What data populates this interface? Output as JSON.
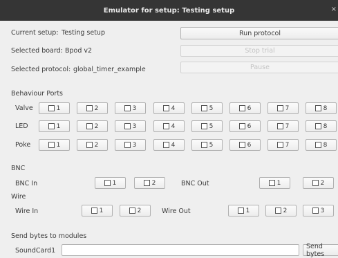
{
  "window": {
    "title": "Emulator for setup: Testing setup",
    "close_glyph": "×"
  },
  "info": {
    "current_setup_label": "Current setup:",
    "current_setup_value": "Testing setup",
    "board_label": "Selected board:",
    "board_value": "Bpod v2",
    "protocol_label": "Selected protocol:",
    "protocol_value": "global_timer_example"
  },
  "buttons": {
    "run": "Run protocol",
    "stop": "Stop trial",
    "pause": "Pause",
    "send": "Send bytes"
  },
  "behaviour": {
    "heading": "Behaviour Ports",
    "rows": [
      "Valve",
      "LED",
      "Poke"
    ],
    "ports": [
      "1",
      "2",
      "3",
      "4",
      "5",
      "6",
      "7",
      "8"
    ]
  },
  "bnc": {
    "heading": "BNC",
    "in_label": "BNC In",
    "out_label": "BNC Out",
    "in_ports": [
      "1",
      "2"
    ],
    "out_ports": [
      "1",
      "2"
    ]
  },
  "wire": {
    "heading": "Wire",
    "in_label": "Wire In",
    "out_label": "Wire Out",
    "in_ports": [
      "1",
      "2"
    ],
    "out_ports": [
      "1",
      "2",
      "3"
    ]
  },
  "modules": {
    "heading": "Send bytes to modules",
    "module_name": "SoundCard1",
    "input_value": ""
  }
}
